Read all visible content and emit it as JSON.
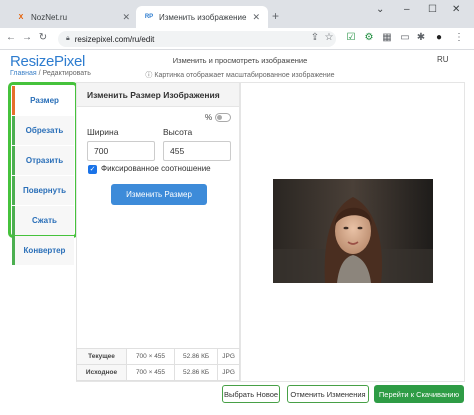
{
  "browser": {
    "tabs": [
      {
        "label": "NozNet.ru",
        "favicon": "X"
      },
      {
        "label": "Изменить изображение | Resiz",
        "favicon": "RP"
      }
    ],
    "url": "resizepixel.com/ru/edit"
  },
  "site": {
    "logo": "ResizePixel",
    "breadcrumb_home": "Главная",
    "breadcrumb_sep": " / ",
    "breadcrumb_current": "Редактировать",
    "header_title": "Изменить и просмотреть изображение",
    "header_sub": "ⓘ Картинка отображает масштабированное изображение",
    "lang": "RU"
  },
  "sidebar": {
    "items": [
      {
        "label": "Размер"
      },
      {
        "label": "Обрезать"
      },
      {
        "label": "Отразить"
      },
      {
        "label": "Повернуть"
      },
      {
        "label": "Сжать"
      },
      {
        "label": "Конвертер"
      }
    ]
  },
  "panel": {
    "title": "Изменить Размер Изображения",
    "percent_label": "%",
    "width_label": "Ширина",
    "height_label": "Высота",
    "width_value": "700",
    "height_value": "455",
    "keep_ratio_label": "Фиксированное соотношение",
    "keep_ratio_checked": true,
    "resize_button": "Изменить Размер"
  },
  "info_table": {
    "rows": [
      {
        "name": "Текущее",
        "dims": "700 × 455",
        "size": "52.86 КБ",
        "format": "JPG"
      },
      {
        "name": "Исходное",
        "dims": "700 × 455",
        "size": "52.86 КБ",
        "format": "JPG"
      }
    ]
  },
  "actions": {
    "choose_new": "Выбрать Новое",
    "cancel_changes": "Отменить Изменения",
    "go_download": "Перейти к Скачиванию"
  },
  "colors": {
    "accent_blue": "#3d8bd9",
    "highlight_green": "#46c23c",
    "download_green": "#2e9c45",
    "active_border": "#e76f2b"
  }
}
